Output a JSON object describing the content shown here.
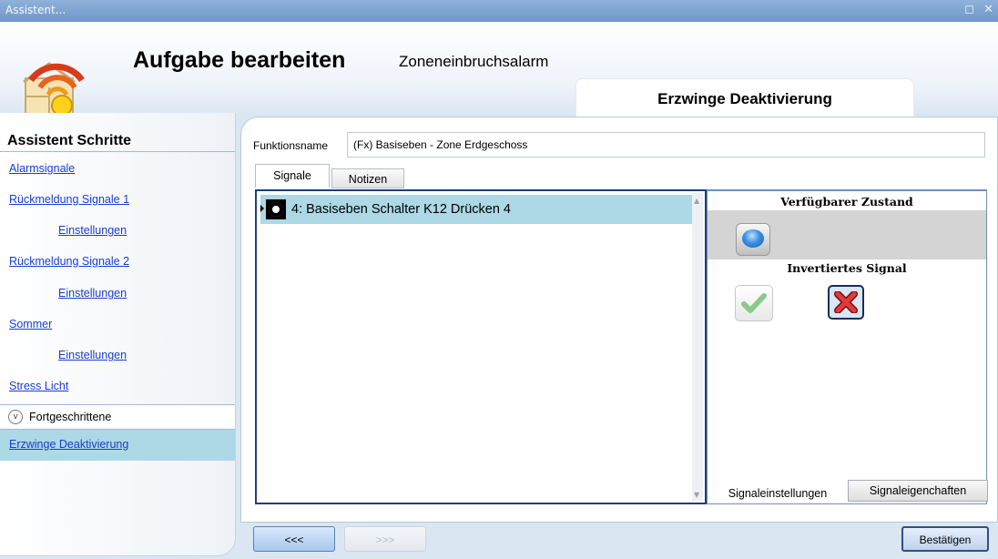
{
  "window": {
    "title": "Assistent...",
    "controls": "◻ ✕"
  },
  "header": {
    "title": "Aufgabe bearbeiten",
    "subtitle": "Zoneneinbruchsalarm",
    "tab_label": "Erzwinge Deaktivierung",
    "logo_icon": "wifi-house-icon"
  },
  "sidebar": {
    "title": "Assistent Schritte",
    "items": [
      {
        "label": "Alarmsignale"
      },
      {
        "label": "Rückmeldung Signale 1"
      },
      {
        "label": "Einstellungen"
      },
      {
        "label": "Rückmeldung Signale 2"
      },
      {
        "label": "Einstellungen"
      },
      {
        "label": "Sommer"
      },
      {
        "label": "Einstellungen"
      },
      {
        "label": "Stress Licht"
      }
    ],
    "advanced_label": "Fortgeschrittene",
    "selected_item": "Erzwinge Deaktivierung"
  },
  "main": {
    "function_name_label": "Funktionsname",
    "function_name_value": "(Fx) Basiseben - Zone Erdgeschoss",
    "tabs": [
      {
        "label": "Signale",
        "active": true
      },
      {
        "label": "Notizen",
        "active": false
      }
    ],
    "signals": [
      {
        "label": "4: Basiseben Schalter K12 Drücken 4",
        "selected": true
      }
    ],
    "right_panel": {
      "available_state_label": "Verfügbarer Zustand",
      "inverted_signal_label": "Invertiertes Signal",
      "tabs": [
        {
          "label": "Signaleinstellungen",
          "active": true
        },
        {
          "label": "Signaleigenchaften",
          "active": false
        }
      ]
    }
  },
  "footer": {
    "back_label": "<<<",
    "forward_label": ">>>",
    "confirm_label": "Bestätigen"
  },
  "colors": {
    "selection": "#add8e6",
    "link": "#1a3cd0",
    "titlebar": "#7aa0cf"
  }
}
